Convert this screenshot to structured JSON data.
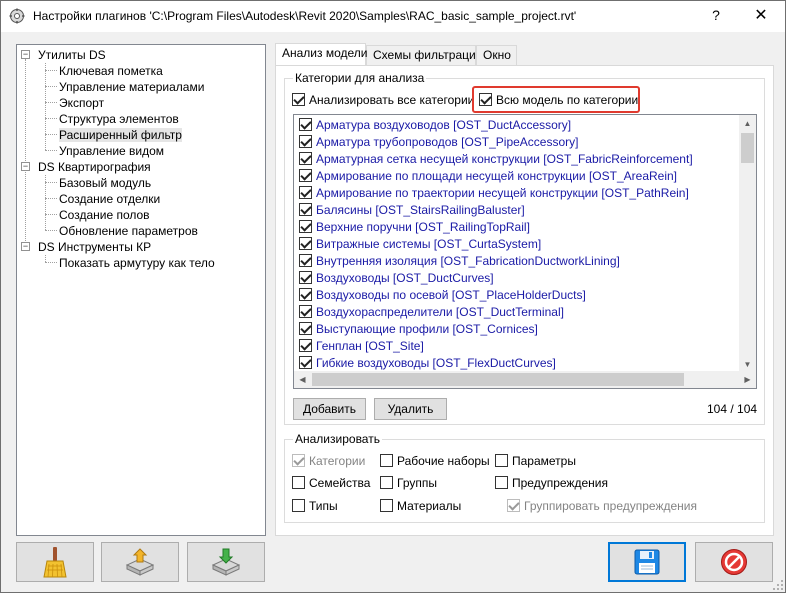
{
  "window": {
    "title": "Настройки плагинов 'C:\\Program Files\\Autodesk\\Revit 2020\\Samples\\RAC_basic_sample_project.rvt'",
    "help": "?",
    "close": "✕"
  },
  "tree": {
    "groups": [
      {
        "label": "Утилиты DS",
        "items": [
          "Ключевая пометка",
          "Управление материалами",
          "Экспорт",
          "Структура элементов",
          "Расширенный фильтр",
          "Управление видом"
        ]
      },
      {
        "label": "DS Квартирография",
        "items": [
          "Базовый модуль",
          "Создание отделки",
          "Создание полов",
          "Обновление параметров"
        ]
      },
      {
        "label": "DS Инструменты КР",
        "items": [
          "Показать армутуру как тело"
        ]
      }
    ],
    "selected": "Расширенный фильтр",
    "expander": "−"
  },
  "tabs": [
    "Анализ модели",
    "Схемы фильтрации",
    "Окно"
  ],
  "categories_group": {
    "legend": "Категории для анализа",
    "analyze_all_label": "Анализировать все категории",
    "whole_model_label": "Всю модель по категории",
    "items": [
      "Арматура воздуховодов [OST_DuctAccessory]",
      "Арматура трубопроводов [OST_PipeAccessory]",
      "Арматурная сетка несущей конструкции [OST_FabricReinforcement]",
      "Армирование по площади несущей конструкции [OST_AreaRein]",
      "Армирование по траектории несущей конструкции [OST_PathRein]",
      "Балясины [OST_StairsRailingBaluster]",
      "Верхние поручни [OST_RailingTopRail]",
      "Витражные системы [OST_CurtaSystem]",
      "Внутренняя изоляция [OST_FabricationDuctworkLining]",
      "Воздуховоды [OST_DuctCurves]",
      "Воздуховоды по осевой [OST_PlaceHolderDucts]",
      "Воздухораспределители [OST_DuctTerminal]",
      "Выступающие профили [OST_Cornices]",
      "Генплан [OST_Site]",
      "Гибкие воздуховоды [OST_FlexDuctCurves]"
    ],
    "add_button": "Добавить",
    "delete_button": "Удалить",
    "count": "104 / 104"
  },
  "analyze_group": {
    "legend": "Анализировать",
    "categories_label": "Категории",
    "worksets_label": "Рабочие наборы",
    "parameters_label": "Параметры",
    "families_label": "Семейства",
    "groups_label": "Группы",
    "warnings_label": "Предупреждения",
    "types_label": "Типы",
    "materials_label": "Материалы",
    "group_warnings_label": "Группировать предупреждения"
  },
  "bottom_buttons": {
    "clear_icon": "broom-icon",
    "import_icon": "disk-import-icon",
    "export_icon": "disk-export-icon",
    "save_icon": "floppy-save-icon",
    "cancel_icon": "no-entry-icon"
  },
  "colors": {
    "highlight": "#e03a2e",
    "category_text": "#1a1aa6",
    "default_button_border": "#0078d7"
  }
}
